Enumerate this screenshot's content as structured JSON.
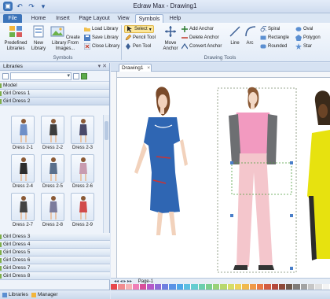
{
  "titlebar": {
    "title": "Edraw Max - Drawing1"
  },
  "tabs": [
    {
      "label": "File"
    },
    {
      "label": "Home"
    },
    {
      "label": "Insert"
    },
    {
      "label": "Page Layout"
    },
    {
      "label": "View"
    },
    {
      "label": "Symbols"
    },
    {
      "label": "Help"
    }
  ],
  "ribbon": {
    "symbols_group": {
      "label": "Symbols",
      "predefined": "Predefined Libraries",
      "new_library": "New Library",
      "create_from_images": "Create Library From Images...",
      "load_library": "Load Library",
      "save_library": "Save Library",
      "close_library": "Close Library"
    },
    "drawing_tools": {
      "label": "Drawing Tools",
      "select": "Select",
      "pencil": "Pencil Tool",
      "pen": "Pen Tool",
      "move_anchor": "Move Anchor",
      "add_anchor": "Add Anchor",
      "delete_anchor": "Delete Anchor",
      "convert_anchor": "Convert Anchor",
      "line": "Line",
      "arc": "Arc",
      "spiral": "Spiral",
      "rectangle": "Rectangle",
      "rounded": "Rounded",
      "oval": "Oval",
      "polygon": "Polygon",
      "star": "Star"
    }
  },
  "libraries": {
    "header": "Libraries",
    "categories_top": [
      "Model",
      "Girl Dress 1",
      "Girl Dress 2"
    ],
    "thumbs": [
      "Dress 2-1",
      "Dress 2-2",
      "Dress 2-3",
      "Dress 2-4",
      "Dress 2-5",
      "Dress 2-6",
      "Dress 2-7",
      "Dress 2-8",
      "Dress 2-9"
    ],
    "categories_bottom": [
      "Girl Dress 3",
      "Girl Dress 4",
      "Girl Dress 5",
      "Girl Dress 6",
      "Girl Dress 7",
      "Girl Dress 8"
    ],
    "bottom_tabs": [
      "Libraries",
      "Manager"
    ]
  },
  "document": {
    "tab": "Drawing1",
    "page": "Page-1"
  },
  "colors": {
    "accent": "#3b73b9",
    "palette": [
      "#e8474b",
      "#f18c8f",
      "#f6b3b5",
      "#ef7fb7",
      "#d84e9a",
      "#b45ac8",
      "#8f6bd6",
      "#6f7fe0",
      "#5a93e6",
      "#4fa8e8",
      "#5cbfe2",
      "#64cdd0",
      "#6ccfae",
      "#7ccf8e",
      "#99d27a",
      "#b8d86e",
      "#d6dd66",
      "#ecd35b",
      "#f0b94f",
      "#f09a48",
      "#e97a45",
      "#d35d41",
      "#b54a3d",
      "#8e4a3a",
      "#6f5a4c",
      "#807c78",
      "#a3a3a3",
      "#c6c6c6",
      "#e0e0e0",
      "#f4f4f4"
    ]
  }
}
